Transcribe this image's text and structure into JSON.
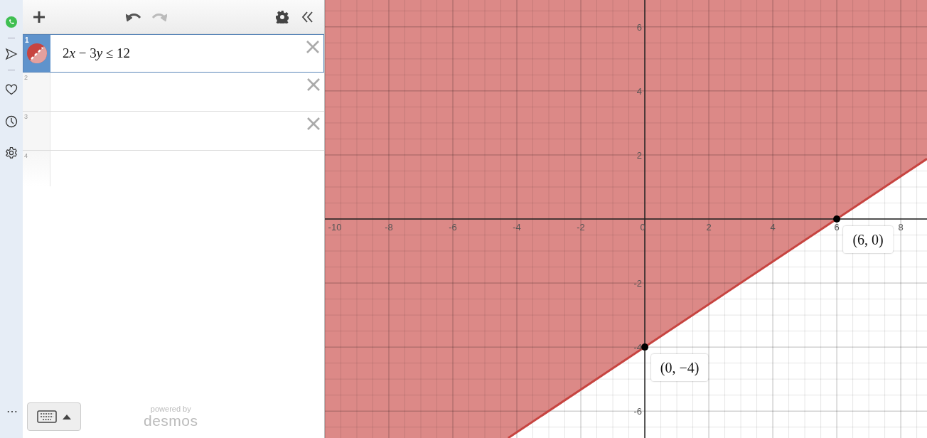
{
  "side_strip": {
    "more": "⋯"
  },
  "toolbar": {
    "undo_enabled": true,
    "redo_enabled": false
  },
  "expressions": [
    {
      "number": "1",
      "tokens": [
        {
          "text": "2",
          "kind": "number"
        },
        {
          "text": "x",
          "kind": "variable"
        },
        {
          "text": " − 3",
          "kind": "number"
        },
        {
          "text": "y",
          "kind": "variable"
        },
        {
          "text": " ≤ 12",
          "kind": "number"
        }
      ],
      "selected": true,
      "color": "#c74440",
      "deletable": true
    },
    {
      "number": "2",
      "selected": false,
      "deletable": true
    },
    {
      "number": "3",
      "selected": false,
      "deletable": true
    },
    {
      "number": "4",
      "selected": false,
      "deletable": false
    }
  ],
  "footer": {
    "powered_by": "powered by",
    "brand": "desmos"
  },
  "graph": {
    "chart_data": {
      "type": "line",
      "grid": true,
      "xlim": [
        -10,
        8.82
      ],
      "ylim": [
        -6.84,
        6.84
      ],
      "xticks": [
        {
          "value": -10,
          "label": "-10"
        },
        {
          "value": -8,
          "label": "-8"
        },
        {
          "value": -6,
          "label": "-6"
        },
        {
          "value": -4,
          "label": "-4"
        },
        {
          "value": -2,
          "label": "-2"
        },
        {
          "value": 0,
          "label": "0"
        },
        {
          "value": 2,
          "label": "2"
        },
        {
          "value": 4,
          "label": "4"
        },
        {
          "value": 6,
          "label": "6"
        },
        {
          "value": 8,
          "label": "8"
        }
      ],
      "yticks": [
        {
          "value": -6,
          "label": "-6"
        },
        {
          "value": -4,
          "label": "-4"
        },
        {
          "value": -2,
          "label": "-2"
        },
        {
          "value": 2,
          "label": "2"
        },
        {
          "value": 4,
          "label": "4"
        },
        {
          "value": 6,
          "label": "6"
        }
      ],
      "x": [
        -4.27,
        8.82
      ],
      "series": [
        {
          "color": "#c74440",
          "values": [
            -6.84,
            1.88
          ]
        }
      ],
      "annotations": [
        {
          "x": 6,
          "y": 0,
          "text": "(6, 0)"
        },
        {
          "x": 0,
          "y": -4,
          "text": "(0, −4)"
        }
      ]
    }
  }
}
